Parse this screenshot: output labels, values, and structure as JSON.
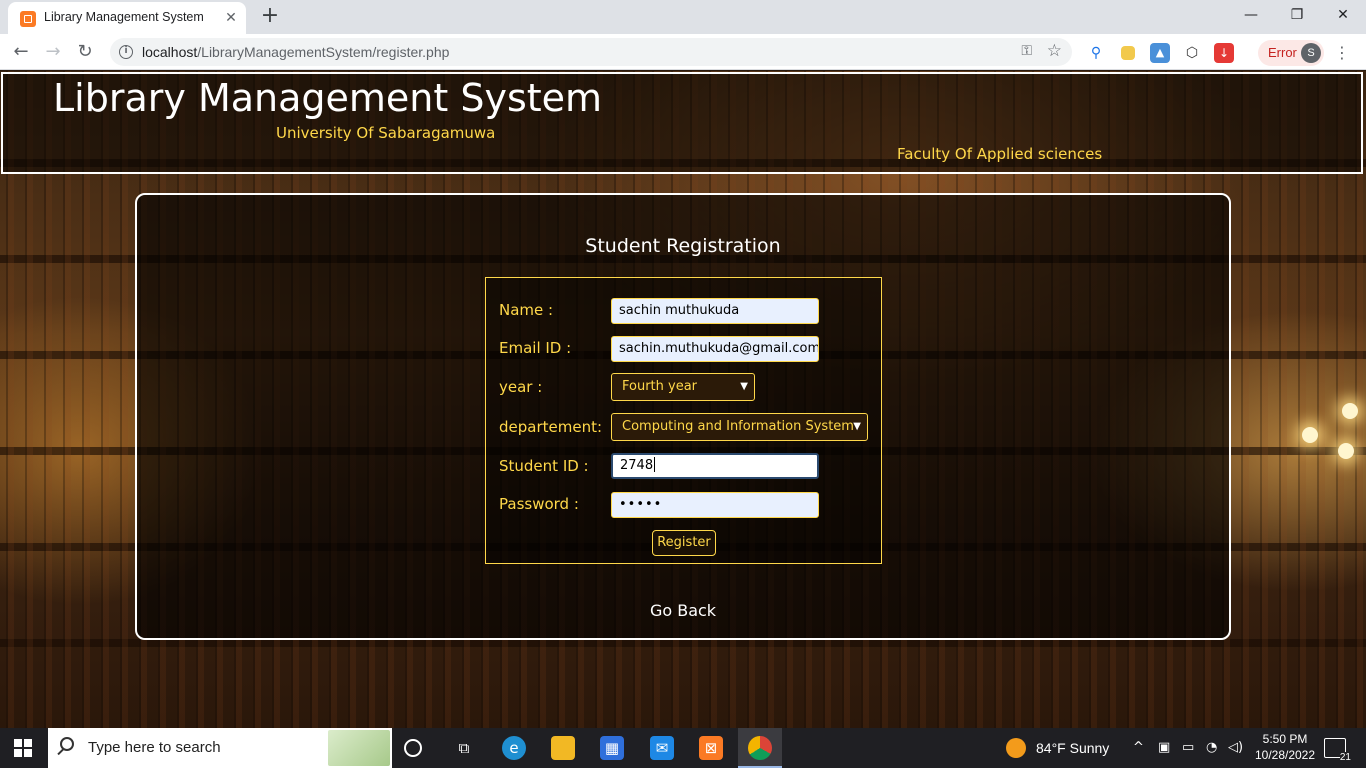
{
  "browser": {
    "tab_title": "Library Management System",
    "tab_close": "✕",
    "new_tab": "+",
    "url_host": "localhost",
    "url_path": "/LibraryManagementSystem/register.php",
    "error_label": "Error",
    "profile_initial": "S",
    "window_controls": {
      "minimize": "—",
      "restore": "❐",
      "close": "✕"
    }
  },
  "header": {
    "title": "Library Management System",
    "university": "University Of Sabaragamuwa",
    "faculty": "Faculty Of Applied sciences"
  },
  "form": {
    "heading": "Student Registration",
    "name_label": "Name :",
    "name_value": "sachin muthukuda",
    "email_label": "Email ID :",
    "email_value": "sachin.muthukuda@gmail.com",
    "year_label": "year :",
    "year_value": "Fourth year",
    "department_label": "departement:",
    "department_value": "Computing and Information System",
    "student_id_label": "Student ID :",
    "student_id_value": "2748",
    "password_label": "Password :",
    "password_value": "•••••",
    "register_label": "Register"
  },
  "go_back": "Go Back",
  "taskbar": {
    "search_placeholder": "Type here to search",
    "weather": "84°F  Sunny",
    "time": "5:50 PM",
    "date": "10/28/2022",
    "notifications": "21"
  },
  "colors": {
    "accent": "#ffd84a",
    "focus_border": "#2b4a6f",
    "input_bg": "#e8f0fe"
  }
}
